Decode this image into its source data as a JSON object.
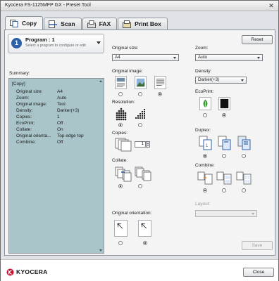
{
  "window": {
    "title": "Kyocera FS-1125MFP GX - Preset Tool",
    "close_glyph": "✕"
  },
  "tabs": [
    {
      "label": "Copy",
      "icon": "copy-icon",
      "active": true
    },
    {
      "label": "Scan",
      "icon": "scan-icon",
      "active": false
    },
    {
      "label": "FAX",
      "icon": "fax-icon",
      "active": false
    },
    {
      "label": "Print Box",
      "icon": "print-box-icon",
      "active": false
    }
  ],
  "program": {
    "badge": "1",
    "title": "Program : 1",
    "hint": "Select a program to configure or edit"
  },
  "reset_label": "Reset",
  "summary": {
    "label": "Summary:",
    "heading": "[Copy]",
    "rows": [
      {
        "key": "Original size:",
        "value": "A4"
      },
      {
        "key": "Zoom:",
        "value": "Auto"
      },
      {
        "key": "Original image:",
        "value": "Text"
      },
      {
        "key": "Density:",
        "value": "Darker(+3)"
      },
      {
        "key": "Copies:",
        "value": "1"
      },
      {
        "key": "EcoPrint:",
        "value": "Off"
      },
      {
        "key": "Collate:",
        "value": "On"
      },
      {
        "key": "Original orienta...",
        "value": "Top edge top"
      },
      {
        "key": "Combine:",
        "value": "Off"
      }
    ]
  },
  "original_size": {
    "label": "Original size:",
    "value": "A4"
  },
  "original_image": {
    "label": "Original image:",
    "options": [
      "text-photo",
      "photo",
      "text"
    ],
    "selected": 2
  },
  "resolution": {
    "label": "Resolution:",
    "options": [
      "resolution-fine",
      "resolution-standard"
    ],
    "selected": 0
  },
  "copies": {
    "label": "Copies:",
    "value": "1"
  },
  "collate": {
    "label": "Collate:",
    "options": [
      "collate-on",
      "collate-off"
    ],
    "selected": 0
  },
  "original_orientation": {
    "label": "Original orientation:",
    "options": [
      "top-edge-top",
      "top-edge-left"
    ],
    "selected": 1
  },
  "zoom": {
    "label": "Zoom:",
    "value": "Auto"
  },
  "density": {
    "label": "Density:",
    "value": "Darker(+3)"
  },
  "ecoprint": {
    "label": "EcoPrint:",
    "options": [
      "ecoprint-on",
      "ecoprint-off"
    ],
    "selected": 1
  },
  "duplex": {
    "label": "Duplex:",
    "options": [
      "1-sided-to-1-sided",
      "1-sided-to-2-sided",
      "2-sided-to-2-sided"
    ],
    "selected": 0
  },
  "combine": {
    "label": "Combine:",
    "options": [
      "combine-off",
      "combine-2-in-1",
      "combine-4-in-1"
    ],
    "selected": 0
  },
  "layout": {
    "label": "Layout:",
    "value": ""
  },
  "save_label": "Save",
  "close_label": "Close",
  "brand": {
    "name": "KYOCERA",
    "color": "#c8102e"
  },
  "colors": {
    "summary_bg": "#a9c5c9",
    "accent_blue": "#2f5fa5",
    "eco_green": "#3f9e3b"
  }
}
